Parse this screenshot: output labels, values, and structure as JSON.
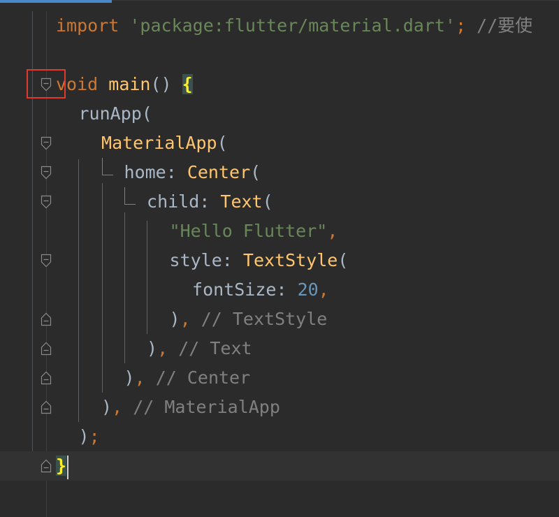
{
  "editor": {
    "lines": [
      {
        "segments": [
          {
            "cls": "kw",
            "text": "import "
          },
          {
            "cls": "str",
            "text": "'package:flutter/material.dart'"
          },
          {
            "cls": "kw",
            "text": ";"
          },
          {
            "cls": "cm",
            "text": " //要使"
          }
        ]
      },
      {
        "segments": []
      },
      {
        "segments": [
          {
            "cls": "kw",
            "text": "void "
          },
          {
            "cls": "fn",
            "text": "main"
          },
          {
            "cls": "plain",
            "text": "() "
          },
          {
            "cls": "brace-hl",
            "text": "{"
          }
        ]
      },
      {
        "segments": [
          {
            "cls": "plain",
            "text": "runApp("
          }
        ]
      },
      {
        "segments": [
          {
            "cls": "fn",
            "text": "MaterialApp"
          },
          {
            "cls": "plain",
            "text": "("
          }
        ]
      },
      {
        "segments": [
          {
            "cls": "plain",
            "text": "home: "
          },
          {
            "cls": "fn",
            "text": "Center"
          },
          {
            "cls": "plain",
            "text": "("
          }
        ]
      },
      {
        "segments": [
          {
            "cls": "plain",
            "text": "child: "
          },
          {
            "cls": "fn",
            "text": "Text"
          },
          {
            "cls": "plain",
            "text": "("
          }
        ]
      },
      {
        "segments": [
          {
            "cls": "str",
            "text": "\"Hello Flutter\""
          },
          {
            "cls": "kw",
            "text": ","
          }
        ]
      },
      {
        "segments": [
          {
            "cls": "plain",
            "text": "style: "
          },
          {
            "cls": "fn",
            "text": "TextStyle"
          },
          {
            "cls": "plain",
            "text": "("
          }
        ]
      },
      {
        "segments": [
          {
            "cls": "plain",
            "text": "fontSize: "
          },
          {
            "cls": "num",
            "text": "20"
          },
          {
            "cls": "kw",
            "text": ","
          }
        ]
      },
      {
        "segments": [
          {
            "cls": "plain",
            "text": ")"
          },
          {
            "cls": "kw",
            "text": ","
          },
          {
            "cls": "cm",
            "text": " // TextStyle"
          }
        ]
      },
      {
        "segments": [
          {
            "cls": "plain",
            "text": ")"
          },
          {
            "cls": "kw",
            "text": ","
          },
          {
            "cls": "cm",
            "text": " // Text"
          }
        ]
      },
      {
        "segments": [
          {
            "cls": "plain",
            "text": ")"
          },
          {
            "cls": "kw",
            "text": ","
          },
          {
            "cls": "cm",
            "text": " // Center"
          }
        ]
      },
      {
        "segments": [
          {
            "cls": "plain",
            "text": ")"
          },
          {
            "cls": "kw",
            "text": ","
          },
          {
            "cls": "cm",
            "text": " // MaterialApp"
          }
        ]
      },
      {
        "segments": [
          {
            "cls": "plain",
            "text": ")"
          },
          {
            "cls": "kw",
            "text": ";"
          }
        ]
      },
      {
        "segments": [
          {
            "cls": "brace-hl",
            "text": "}"
          }
        ]
      }
    ]
  },
  "fold_markers": [
    {
      "line": 2,
      "kind": "fold-start"
    },
    {
      "line": 4,
      "kind": "fold-start"
    },
    {
      "line": 5,
      "kind": "fold-start"
    },
    {
      "line": 6,
      "kind": "fold-start"
    },
    {
      "line": 8,
      "kind": "fold-start"
    },
    {
      "line": 10,
      "kind": "fold-end"
    },
    {
      "line": 11,
      "kind": "fold-end"
    },
    {
      "line": 12,
      "kind": "fold-end"
    },
    {
      "line": 13,
      "kind": "fold-end"
    },
    {
      "line": 15,
      "kind": "fold-end"
    }
  ],
  "colors": {
    "background": "#2b2b2b",
    "keyword": "#cc7832",
    "string": "#6a8759",
    "function": "#ffc66d",
    "number": "#6897bb",
    "comment": "#808080",
    "text": "#a9b7c6",
    "annotation_box": "#e03a2f"
  }
}
